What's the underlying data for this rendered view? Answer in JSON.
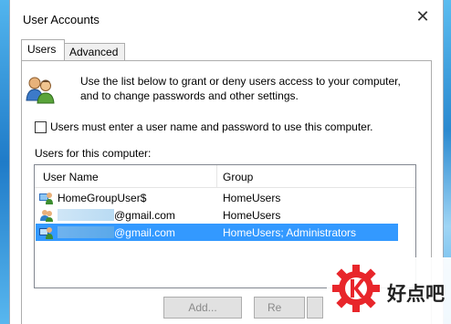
{
  "window": {
    "title": "User Accounts",
    "close_glyph": "✕"
  },
  "tabs": [
    {
      "label": "Users",
      "active": true
    },
    {
      "label": "Advanced",
      "active": false
    }
  ],
  "intro": {
    "icon": "users-icon",
    "text": "Use the list below to grant or deny users access to your computer, and to change passwords and other settings."
  },
  "require_login": {
    "label": "Users must enter a user name and password to use this computer.",
    "checked": false
  },
  "users_section": {
    "label": "Users for this computer:",
    "columns": {
      "name": "User Name",
      "group": "Group"
    },
    "rows": [
      {
        "name": "HomeGroupUser$",
        "group": "HomeUsers",
        "selected": false,
        "icon": "user-account-icon"
      },
      {
        "name": "@gmail.com",
        "group": "HomeUsers",
        "selected": false,
        "icon": "user-account-icon"
      },
      {
        "name": "@gmail.com",
        "group": "HomeUsers; Administrators",
        "selected": true,
        "icon": "user-account-icon"
      }
    ]
  },
  "buttons": {
    "add": "Add...",
    "remove": "Re",
    "properties": ""
  },
  "watermark": {
    "text": "好点吧",
    "logo": "gear-k-logo-icon",
    "color": "#e8262b"
  }
}
